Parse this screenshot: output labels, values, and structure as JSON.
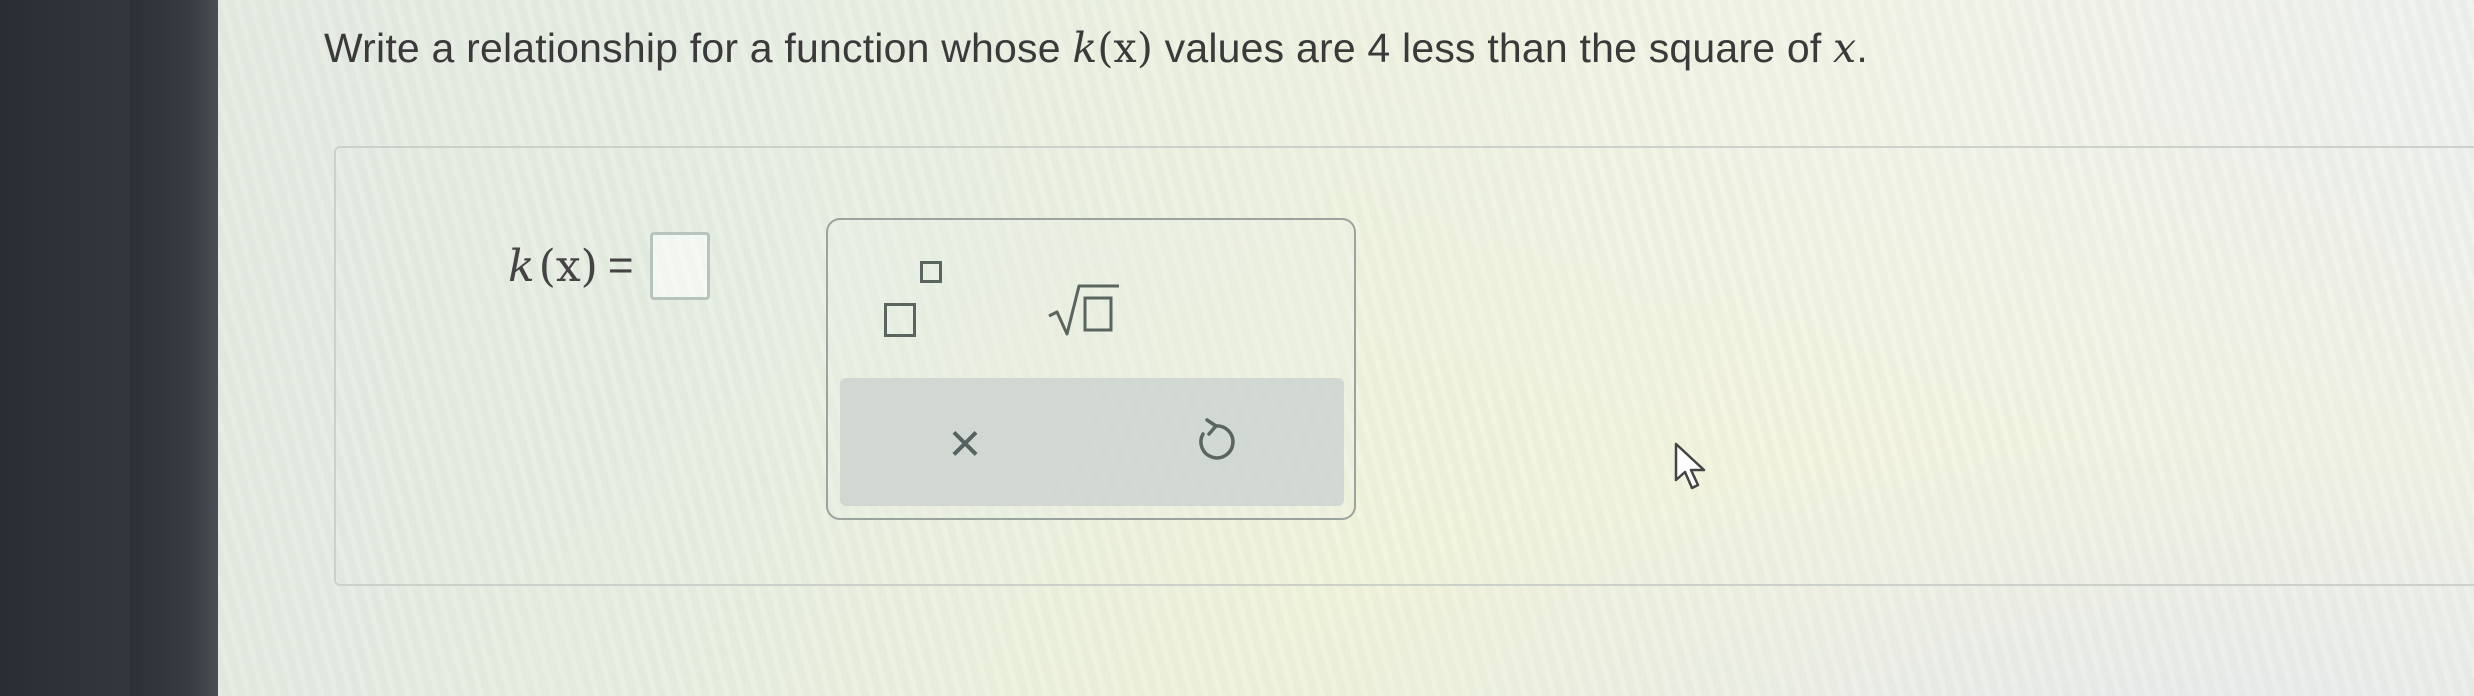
{
  "question": {
    "prefix": "Write a relationship for a function whose ",
    "func_name": "k",
    "func_arg": "(x)",
    "middle": " values are 4 less than the square of ",
    "var": "x",
    "suffix": "."
  },
  "answer": {
    "func_name": "k",
    "func_arg": "(x)",
    "equals": "=",
    "value": ""
  },
  "palette": {
    "tools": [
      {
        "name": "superscript-icon"
      },
      {
        "name": "square-root-icon"
      }
    ],
    "clear_label": "×",
    "undo_label": "↺"
  },
  "colors": {
    "background": "#e6ede2",
    "bezel": "#2f3238",
    "palette_border": "#9ba39e",
    "action_bar": "#cdd4d0",
    "icon": "#5a6560"
  }
}
